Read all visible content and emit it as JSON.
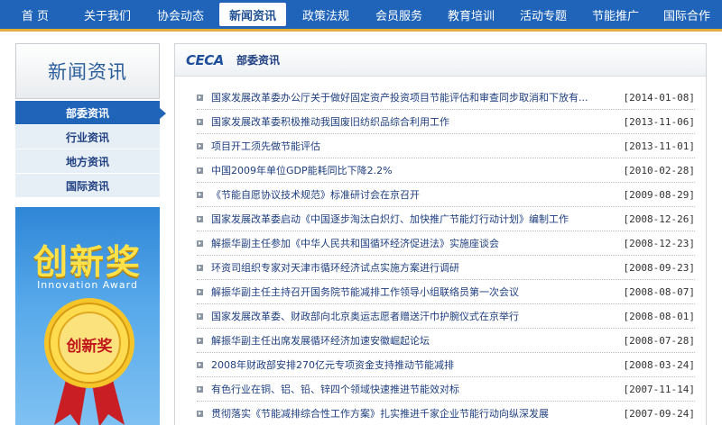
{
  "nav": {
    "items": [
      {
        "label": "首 页"
      },
      {
        "label": "关于我们"
      },
      {
        "label": "协会动态"
      },
      {
        "label": "新闻资讯"
      },
      {
        "label": "政策法规"
      },
      {
        "label": "会员服务"
      },
      {
        "label": "教育培训"
      },
      {
        "label": "活动专题"
      },
      {
        "label": "节能推广"
      },
      {
        "label": "国际合作"
      }
    ],
    "active_index": 3,
    "bg_color": "#1f64b9",
    "stripe_color": "#e3ad3a"
  },
  "sidebar": {
    "title": "新闻资讯",
    "items": [
      {
        "label": "部委资讯"
      },
      {
        "label": "行业资讯"
      },
      {
        "label": "地方资讯"
      },
      {
        "label": "国际资讯"
      }
    ],
    "active_index": 0
  },
  "banner": {
    "title": "创新奖",
    "subtitle": "Innovation Award",
    "medal_text": "创新奖"
  },
  "main": {
    "logo_text": "CECA",
    "title": "部委资讯",
    "news": [
      {
        "title": "国家发展改革委办公厅关于做好固定资产投资项目节能评估和审查同步取消和下放有...",
        "date": "[2014-01-08]"
      },
      {
        "title": "国家发展改革委积极推动我国废旧纺织品综合利用工作",
        "date": "[2013-11-06]"
      },
      {
        "title": "项目开工须先做节能评估",
        "date": "[2013-11-01]"
      },
      {
        "title": "中国2009年单位GDP能耗同比下降2.2%",
        "date": "[2010-02-28]"
      },
      {
        "title": "《节能自愿协议技术规范》标准研讨会在京召开",
        "date": "[2009-08-29]"
      },
      {
        "title": "国家发展改革委启动《中国逐步淘汰白炽灯、加快推广节能灯行动计划》编制工作",
        "date": "[2008-12-26]"
      },
      {
        "title": "解振华副主任参加《中华人民共和国循环经济促进法》实施座谈会",
        "date": "[2008-12-23]"
      },
      {
        "title": "环资司组织专家对天津市循环经济试点实施方案进行调研",
        "date": "[2008-09-23]"
      },
      {
        "title": "解振华副主任主持召开国务院节能减排工作领导小组联络员第一次会议",
        "date": "[2008-08-07]"
      },
      {
        "title": "国家发展改革委、财政部向北京奥运志愿者赠送汗巾护腕仪式在京举行",
        "date": "[2008-08-01]"
      },
      {
        "title": "解振华副主任出席发展循环经济加速安徽崛起论坛",
        "date": "[2008-07-28]"
      },
      {
        "title": "2008年财政部安排270亿元专项资金支持推动节能减排",
        "date": "[2008-03-24]"
      },
      {
        "title": "有色行业在铜、铝、铅、锌四个领域快速推进节能效对标",
        "date": "[2007-11-14]"
      },
      {
        "title": "贯彻落实《节能减排综合性工作方案》扎实推进千家企业节能行动向纵深发展",
        "date": "[2007-09-24]"
      }
    ]
  }
}
